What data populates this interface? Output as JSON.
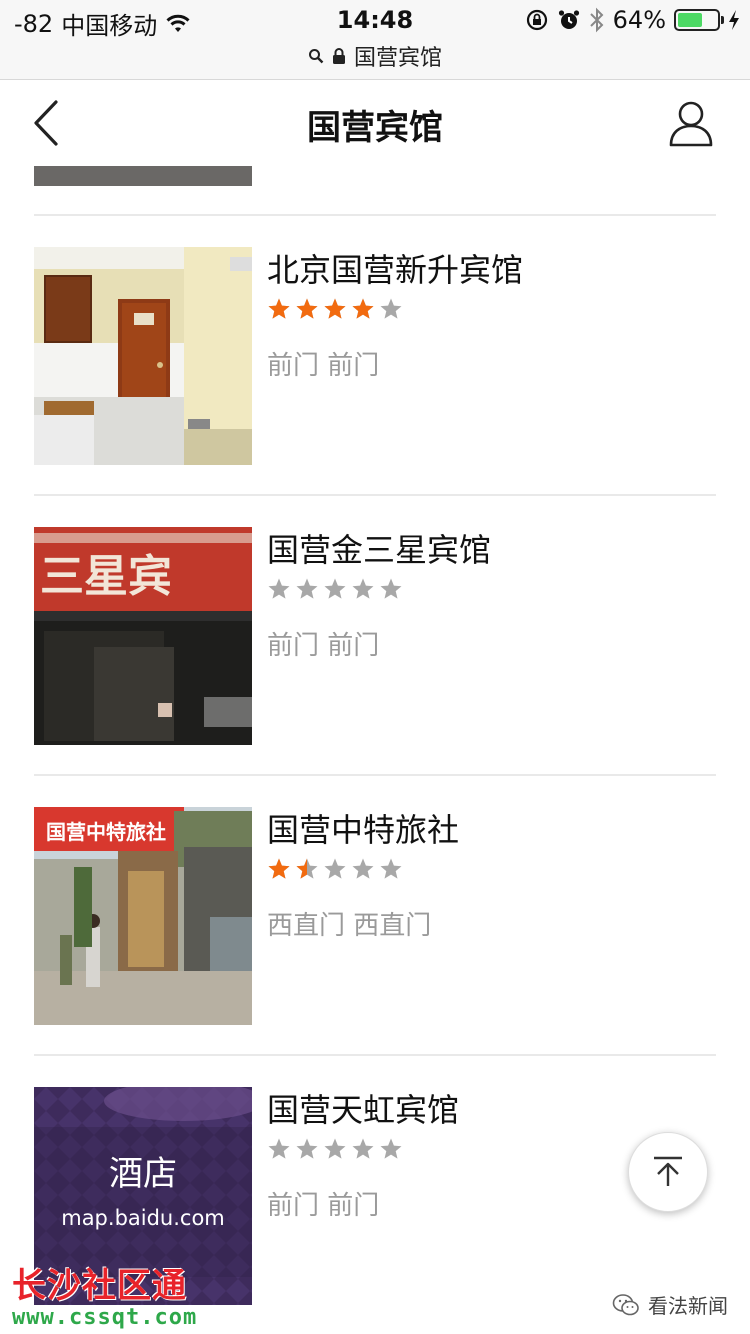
{
  "status_bar": {
    "signal": "-82",
    "carrier": "中国移动",
    "time": "14:48",
    "battery_percent": "64%",
    "battery_level": 0.64,
    "url_text": "国营宾馆"
  },
  "nav": {
    "title": "国营宾馆"
  },
  "hotels": [
    {
      "name": "北京国营新升宾馆",
      "rating": 4,
      "location": "前门 前门",
      "thumb": "room"
    },
    {
      "name": "国营金三星宾馆",
      "rating": 0,
      "location": "前门 前门",
      "thumb": "sign",
      "sign_text": "三星宾"
    },
    {
      "name": "国营中特旅社",
      "rating": 1.5,
      "location": "西直门 西直门",
      "thumb": "street",
      "sign_text": "国营中特旅社"
    },
    {
      "name": "国营天虹宾馆",
      "rating": 0,
      "location": "前门 前门",
      "thumb": "placeholder",
      "thumb_title": "酒店",
      "thumb_url": "map.baidu.com"
    }
  ],
  "colors": {
    "star_active": "#f26b10",
    "star_inactive": "#a8a8a8",
    "watermark_red": "#e8232a",
    "watermark_green": "#2ea84a"
  },
  "watermark": {
    "left_title": "长沙社区通",
    "left_url": "www.cssqt.com",
    "right_text": "看法新闻"
  },
  "icons": [
    "back-chevron-icon",
    "user-icon",
    "search-icon",
    "lock-icon",
    "wifi-icon",
    "alarm-icon",
    "bluetooth-icon",
    "charging-icon",
    "scroll-to-top-icon",
    "wechat-icon"
  ]
}
